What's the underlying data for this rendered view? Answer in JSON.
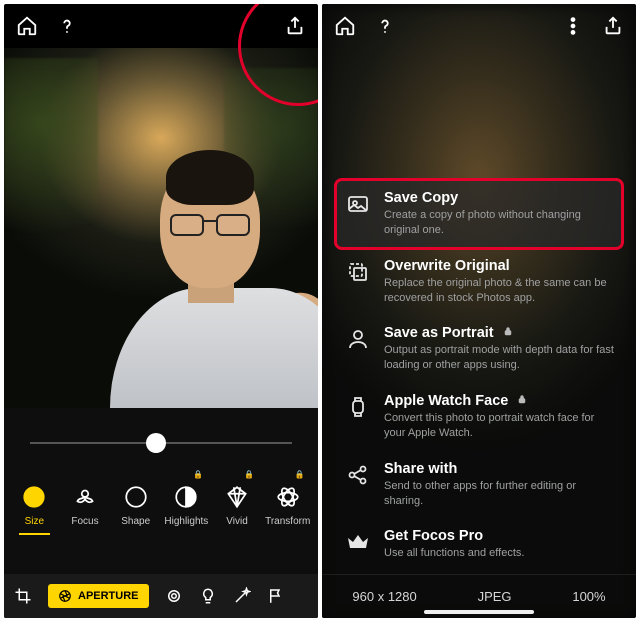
{
  "left": {
    "modes": [
      {
        "key": "size",
        "label": "Size"
      },
      {
        "key": "focus",
        "label": "Focus"
      },
      {
        "key": "shape",
        "label": "Shape"
      },
      {
        "key": "highlights",
        "label": "Highlights"
      },
      {
        "key": "vivid",
        "label": "Vivid"
      },
      {
        "key": "transform",
        "label": "Transform"
      }
    ],
    "aperture_label": "APERTURE"
  },
  "right": {
    "options": [
      {
        "key": "save-copy",
        "title": "Save Copy",
        "desc": "Create a copy of photo without changing original one.",
        "locked": false
      },
      {
        "key": "overwrite",
        "title": "Overwrite Original",
        "desc": "Replace the original photo & the same can be recovered in stock Photos app.",
        "locked": false
      },
      {
        "key": "save-portrait",
        "title": "Save as Portrait",
        "desc": "Output as portrait mode with depth data for fast loading or other apps using.",
        "locked": true
      },
      {
        "key": "watch-face",
        "title": "Apple Watch Face",
        "desc": "Convert this photo to portrait watch face for your Apple Watch.",
        "locked": true
      },
      {
        "key": "share",
        "title": "Share with",
        "desc": "Send to other apps for further editing or sharing.",
        "locked": false
      },
      {
        "key": "get-pro",
        "title": "Get Focos Pro",
        "desc": "Use all functions and effects.",
        "locked": false
      }
    ],
    "meta": {
      "dimensions": "960 x 1280",
      "format": "JPEG",
      "quality": "100%"
    }
  }
}
